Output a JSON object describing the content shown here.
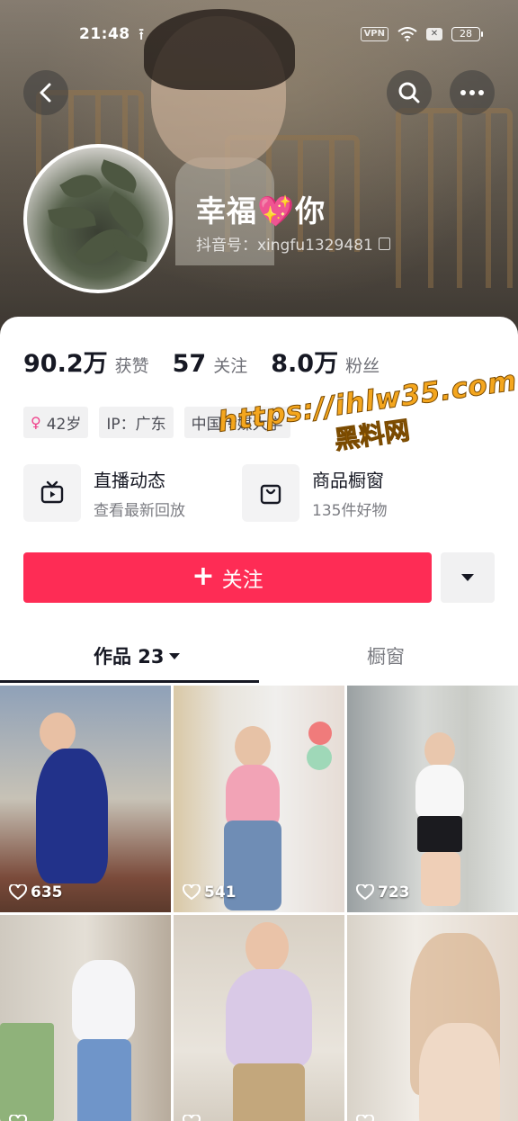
{
  "status_bar": {
    "time": "21:48",
    "vpn_label": "VPN",
    "battery": "28"
  },
  "profile": {
    "nickname": "幸福💖你",
    "douyin_id": "抖音号：xingfu1329481"
  },
  "stats": [
    {
      "value": "90.2万",
      "label": "获赞"
    },
    {
      "value": "57",
      "label": "关注"
    },
    {
      "value": "8.0万",
      "label": "粉丝"
    }
  ],
  "tags": {
    "age": "42岁",
    "ip": "IP：广东",
    "school": "中国传媒大学"
  },
  "shortcuts": {
    "live": {
      "title": "直播动态",
      "subtitle": "查看最新回放"
    },
    "shop": {
      "title": "商品橱窗",
      "subtitle": "135件好物"
    }
  },
  "actions": {
    "follow_label": "关注"
  },
  "tabs": {
    "works": "作品 23",
    "showcase": "橱窗"
  },
  "videos": [
    {
      "likes": "635"
    },
    {
      "likes": "541"
    },
    {
      "likes": "723"
    },
    {
      "likes": ""
    },
    {
      "likes": ""
    },
    {
      "likes": ""
    }
  ],
  "watermark": {
    "url": "https://ihlw35.com",
    "name": "黑料网"
  },
  "colors": {
    "accent": "#fe2c55",
    "text_primary": "#161823",
    "text_secondary": "#7b7c82"
  }
}
